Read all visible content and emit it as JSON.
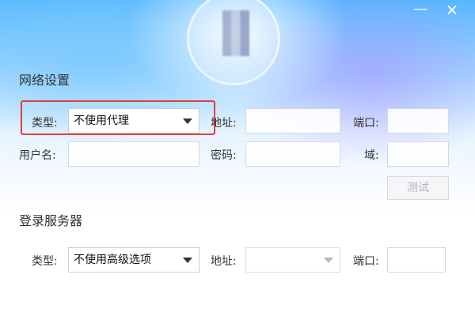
{
  "window": {
    "minimize_icon": "minimize-icon",
    "close_icon": "close-icon",
    "minimize_glyph": "—",
    "close_glyph": "×"
  },
  "network": {
    "title": "网络设置",
    "type_label": "类型:",
    "type_value": "不使用代理",
    "address_label": "地址:",
    "address_value": "",
    "port_label": "端口:",
    "port_value": "",
    "username_label": "用户名:",
    "username_value": "",
    "password_label": "密码:",
    "password_value": "",
    "domain_label": "域:",
    "domain_value": "",
    "test_button": "测试"
  },
  "login_server": {
    "title": "登录服务器",
    "type_label": "类型:",
    "type_value": "不使用高级选项",
    "address_label": "地址:",
    "address_value": "",
    "port_label": "端口:",
    "port_value": ""
  },
  "colors": {
    "highlight": "#e0403a",
    "header_gradient_top": "#55b8ff"
  }
}
